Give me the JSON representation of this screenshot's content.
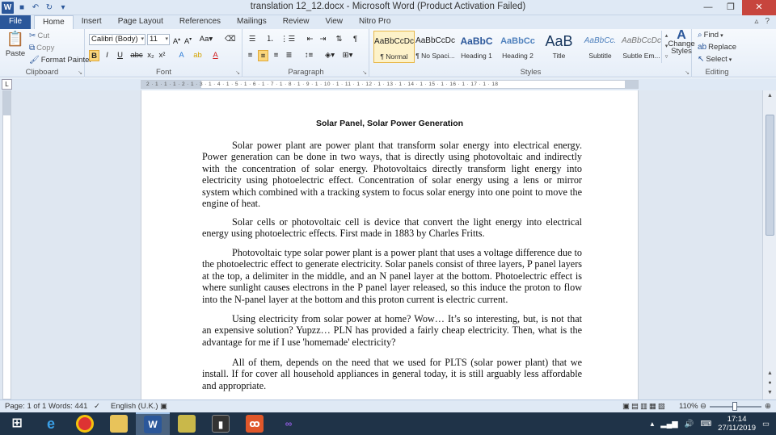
{
  "window": {
    "title": "translation 12_12.docx  -  Microsoft Word (Product Activation Failed)"
  },
  "tabs": [
    "File",
    "Home",
    "Insert",
    "Page Layout",
    "References",
    "Mailings",
    "Review",
    "View",
    "Nitro Pro"
  ],
  "clipboard": {
    "label": "Clipboard",
    "paste": "Paste",
    "cut": "Cut",
    "copy": "Copy",
    "format_painter": "Format Painter"
  },
  "font": {
    "label": "Font",
    "name": "Calibri (Body)",
    "size": "11"
  },
  "paragraph": {
    "label": "Paragraph"
  },
  "styles": {
    "label": "Styles",
    "items": [
      {
        "preview": "AaBbCcDc",
        "name": "¶ Normal"
      },
      {
        "preview": "AaBbCcDc",
        "name": "¶ No Spaci..."
      },
      {
        "preview": "AaBbC",
        "name": "Heading 1"
      },
      {
        "preview": "AaBbCc",
        "name": "Heading 2"
      },
      {
        "preview": "AaB",
        "name": "Title"
      },
      {
        "preview": "AaBbCc.",
        "name": "Subtitle"
      },
      {
        "preview": "AaBbCcDc",
        "name": "Subtle Em..."
      }
    ],
    "change_styles": "Change Styles"
  },
  "editing": {
    "label": "Editing",
    "find": "Find",
    "replace": "Replace",
    "select": "Select"
  },
  "ruler": {
    "text": "2 · 1 · 1 · 1 · 2 · 1 · 3 · 1 · 4 · 1 · 5 · 1 · 6 · 1 · 7 · 1 · 8 · 1 · 9 · 1 · 10 · 1 · 11 · 1 · 12 · 1 · 13 · 1 · 14 · 1 · 15 · 1 · 16 · 1 · 17 · 1 · 18"
  },
  "document": {
    "title": "Solar Panel, Solar Power Generation",
    "paragraphs": [
      "Solar power plant are power plant that transform solar energy into electrical energy. Power generation can be done in two ways, that is directly using photovoltaic and indirectly with the concentration of solar energy. Photovoltaics directly transform light energy into electricity using photoelectric effect.  Concentration of solar energy using a lens or mirror system which combined with a tracking system to focus solar energy into one point to move the engine of heat.",
      "Solar cells or photovoltaic cell is device that convert the light energy into electrical energy using photoelectric effects.  First made in 1883  by Charles Fritts.",
      "Photovoltaic type solar power plant is a power plant that uses a voltage difference due to the photoelectric effect to generate electricity. Solar panels consist of three layers, P panel layers at the top, a delimiter in the middle, and an N panel layer at the bottom. Photoelectric effect is where sunlight causes electrons in the P panel layer released, so this induce the proton to flow into the N-panel layer at the bottom and this proton current is electric current.",
      "Using electricity from solar power at home? Wow… It’s so interesting, but,  is not that an expensive solution? Yupzz… PLN has provided a fairly cheap electricity. Then, what is the advantage for me if I use 'homemade' electricity?",
      "All of them, depends on the need that we used for PLTS (solar power plant) that we install. If for cover all household appliances in general today, it is still arguably less affordable and appropriate."
    ]
  },
  "status": {
    "page": "Page: 1 of 1",
    "words": "Words: 441",
    "language": "English (U.K.)",
    "zoom": "110%"
  },
  "taskbar": {
    "time": "17:14",
    "date": "27/11/2019"
  }
}
